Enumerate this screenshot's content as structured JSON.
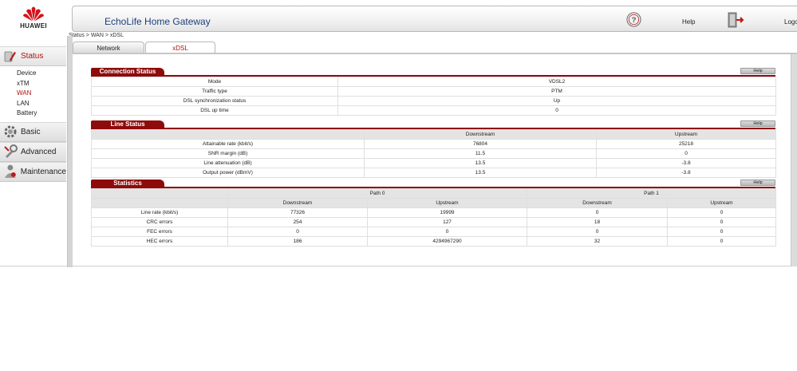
{
  "brand": {
    "name": "HUAWEI",
    "color": "#d5121a"
  },
  "header": {
    "title": "EchoLife Home Gateway",
    "help_label": "Help",
    "logout_label": "Logout"
  },
  "breadcrumb": "Status > WAN > xDSL",
  "tabs": [
    {
      "label": "Network",
      "active": false
    },
    {
      "label": "xDSL",
      "active": true
    }
  ],
  "sidebar": {
    "sections": [
      {
        "label": "Status",
        "icon": "status-icon",
        "active": true,
        "items": [
          "Device",
          "xTM",
          "WAN",
          "LAN",
          "Battery"
        ],
        "current": "WAN"
      },
      {
        "label": "Basic",
        "icon": "basic-icon"
      },
      {
        "label": "Advanced",
        "icon": "advanced-icon"
      },
      {
        "label": "Maintenance",
        "icon": "maintenance-icon"
      }
    ]
  },
  "connection_status": {
    "title": "Connection Status",
    "help": "Help",
    "rows": [
      [
        "Mode",
        "VDSL2"
      ],
      [
        "Traffic type",
        "PTM"
      ],
      [
        "DSL synchronization status",
        "Up"
      ],
      [
        "DSL up time",
        "0"
      ]
    ]
  },
  "line_status": {
    "title": "Line Status",
    "help": "Help",
    "columns": [
      "Downstream",
      "Upstream"
    ],
    "rows": [
      [
        "Attainable rate (kbit/s)",
        "76804",
        "25218"
      ],
      [
        "SNR margin (dB)",
        "11.5",
        "0"
      ],
      [
        "Line attenuation (dB)",
        "13.5",
        "-3.8"
      ],
      [
        "Output power (dBmV)",
        "13.5",
        "-3.8"
      ]
    ]
  },
  "statistics": {
    "title": "Statistics",
    "help": "Help",
    "paths": [
      "Path 0",
      "Path 1"
    ],
    "columns": [
      "Downstream",
      "Upstream",
      "Downstream",
      "Upstream"
    ],
    "rows": [
      [
        "Line rate (kbit/s)",
        "77326",
        "19999",
        "0",
        "0"
      ],
      [
        "CRC errors",
        "254",
        "127",
        "18",
        "0"
      ],
      [
        "FEC errors",
        "0",
        "0",
        "0",
        "0"
      ],
      [
        "HEC errors",
        "186",
        "4294967290",
        "32",
        "0"
      ]
    ]
  },
  "colors": {
    "accent": "#8e0b0b",
    "selected_text": "#b01010",
    "title_text": "#1d3f7a"
  }
}
